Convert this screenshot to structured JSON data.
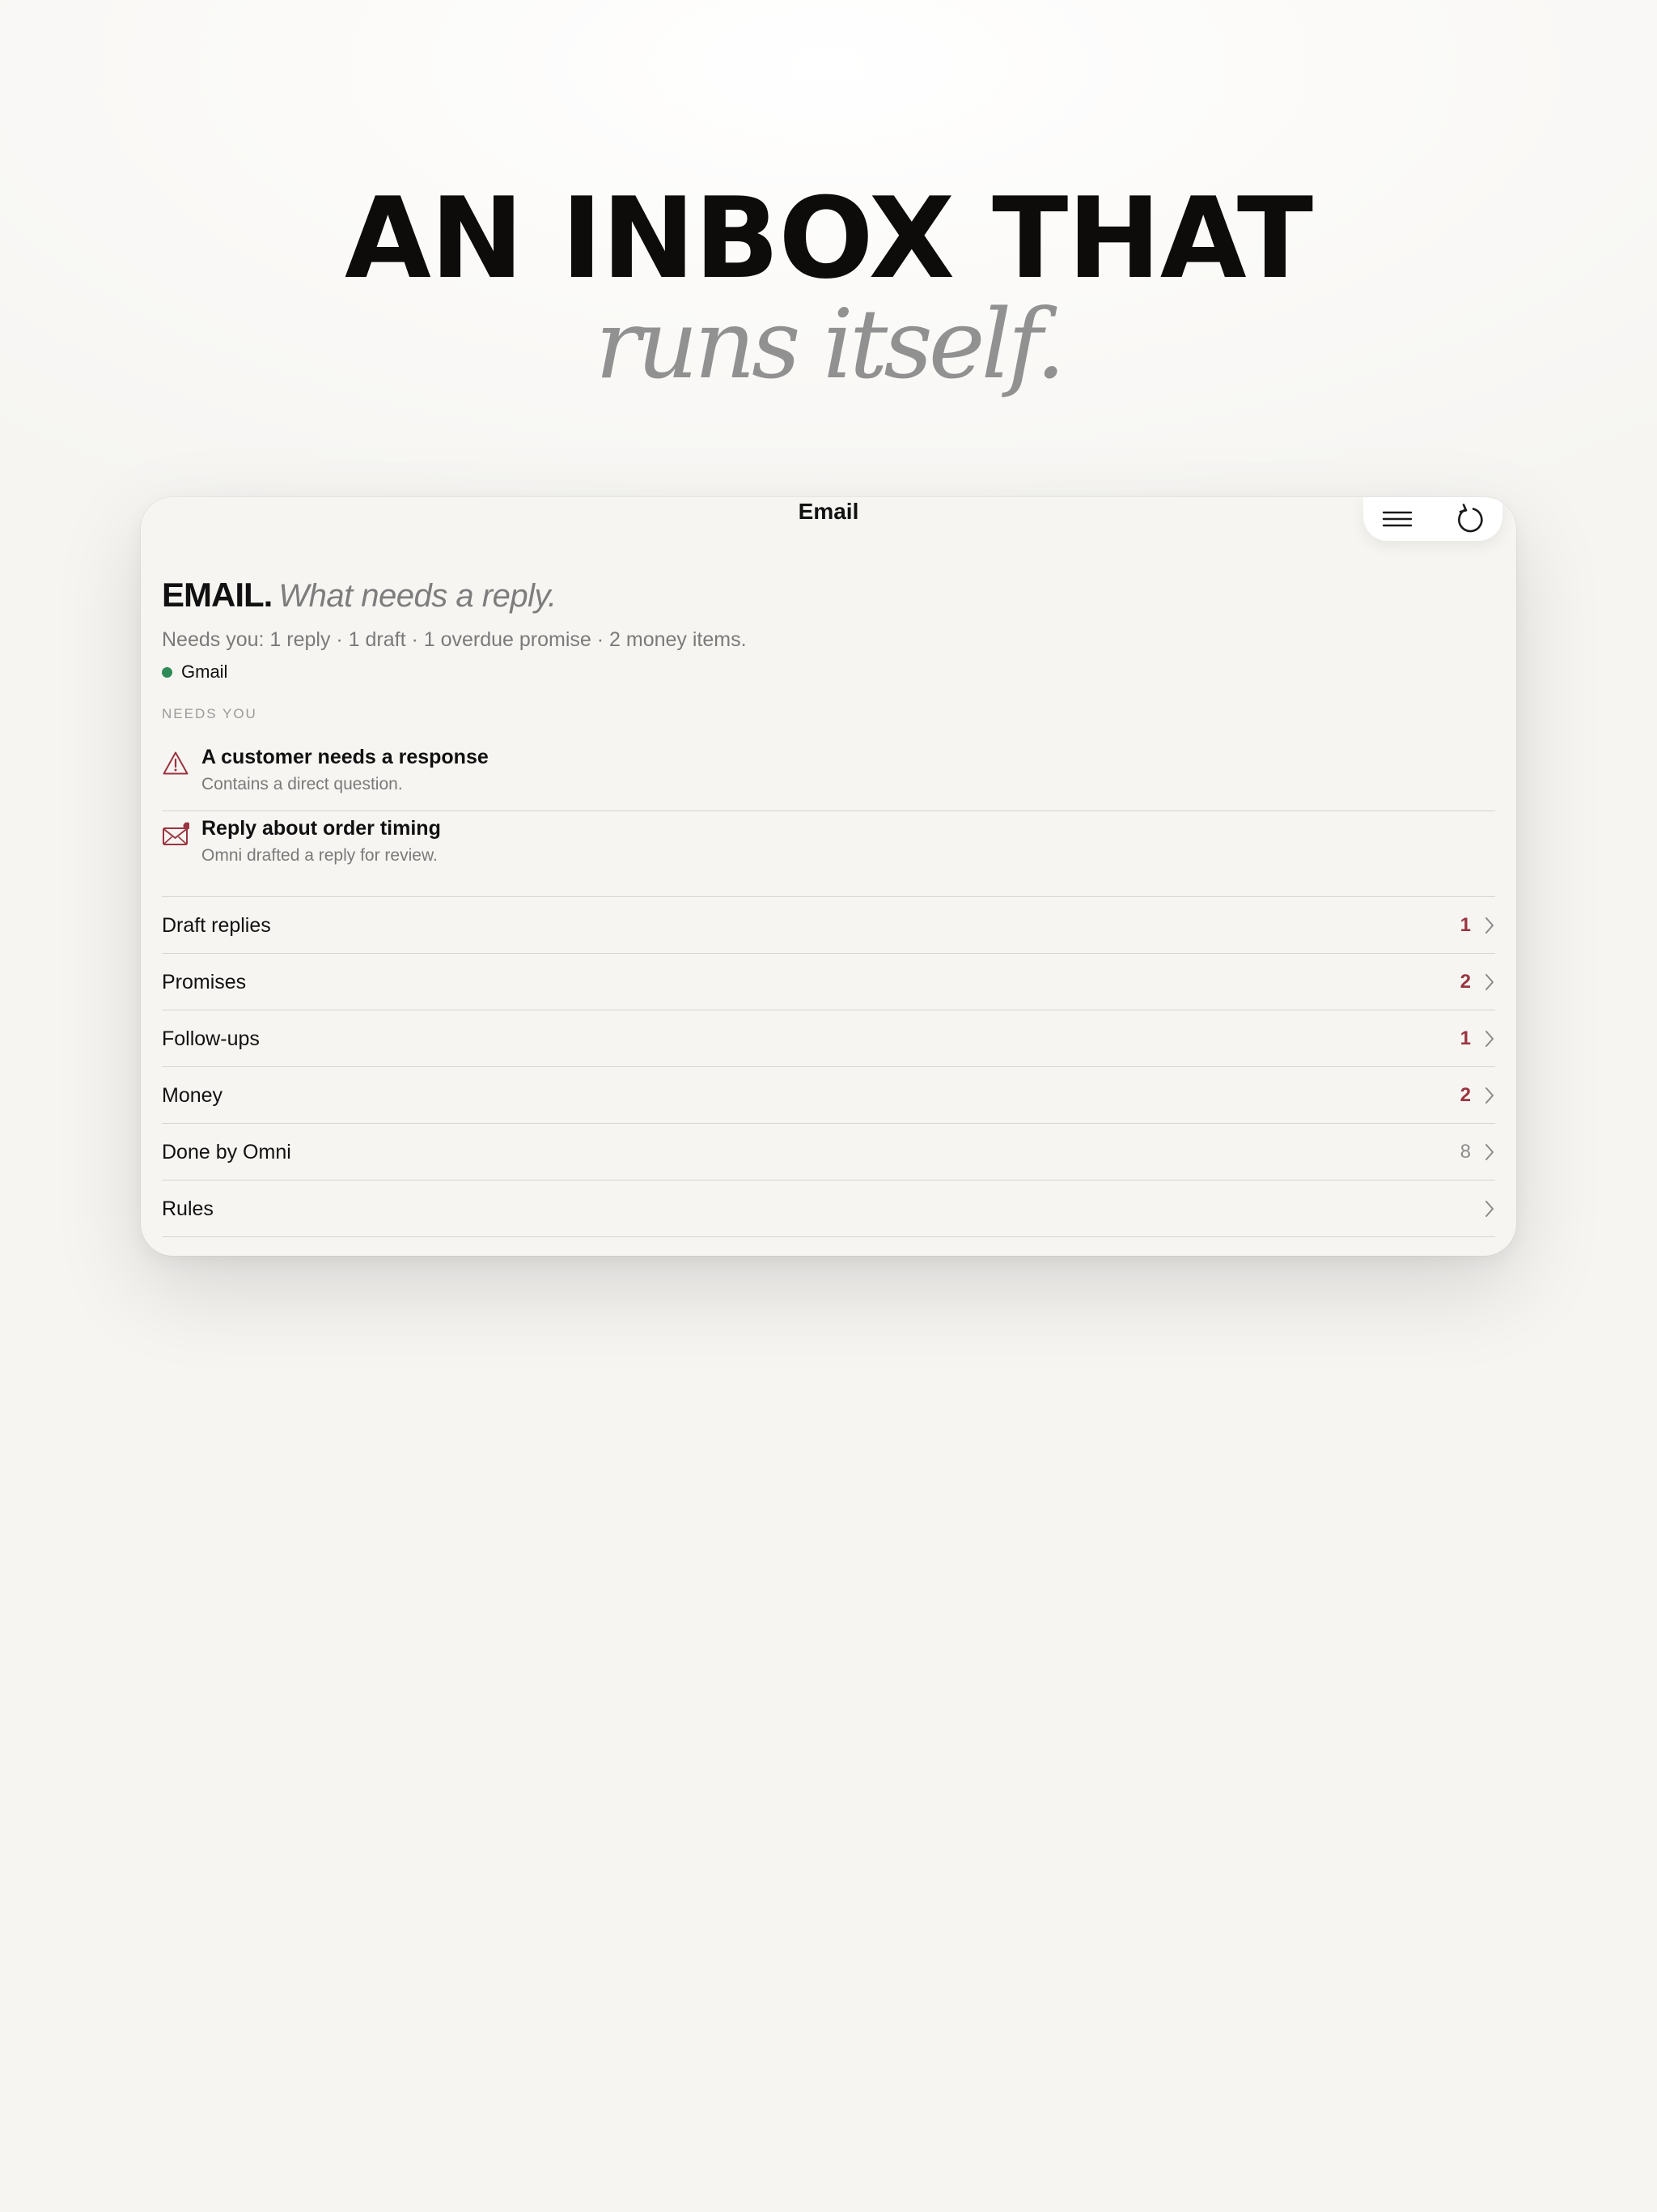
{
  "hero": {
    "headline": "AN INBOX THAT",
    "subline": "runs itself."
  },
  "window": {
    "title": "Email",
    "toolbar": {
      "menu_icon": "menu-icon",
      "refresh_icon": "refresh-icon"
    }
  },
  "header": {
    "title_strong": "EMAIL.",
    "title_italic": "What needs a reply.",
    "summary": "Needs you: 1 reply · 1 draft · 1 overdue promise · 2 money items.",
    "source": {
      "name": "Gmail",
      "status_color": "#2e8b57"
    }
  },
  "needs_you": {
    "label": "NEEDS YOU",
    "items": [
      {
        "icon": "warning-icon",
        "title": "A customer needs a response",
        "subtitle": "Contains a direct question."
      },
      {
        "icon": "mail-unread-icon",
        "title": "Reply about order timing",
        "subtitle": "Omni drafted a reply for review."
      }
    ]
  },
  "categories": [
    {
      "label": "Draft replies",
      "count": "1",
      "highlight": true
    },
    {
      "label": "Promises",
      "count": "2",
      "highlight": true
    },
    {
      "label": "Follow-ups",
      "count": "1",
      "highlight": true
    },
    {
      "label": "Money",
      "count": "2",
      "highlight": true
    },
    {
      "label": "Done by Omni",
      "count": "8",
      "highlight": false
    },
    {
      "label": "Rules",
      "count": "",
      "highlight": false
    }
  ],
  "colors": {
    "accent": "#9a3440",
    "muted": "#8d8d8d",
    "background": "#f6f5f2"
  }
}
